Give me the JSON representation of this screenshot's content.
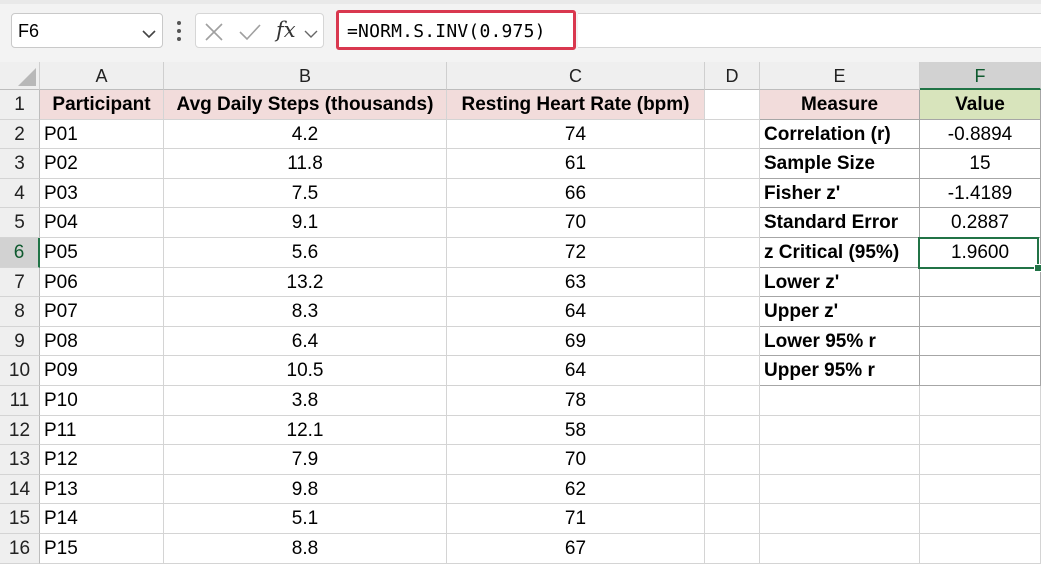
{
  "name_box": {
    "value": "F6",
    "icon": "chevron-down-icon"
  },
  "formula_bar": {
    "formula": "=NORM.S.INV(0.975)",
    "cancel_icon": "close-icon",
    "enter_icon": "checkmark-icon",
    "function_label": "fx",
    "menu_icon": "vertical-dots-icon"
  },
  "columns": [
    "A",
    "B",
    "C",
    "D",
    "E",
    "F"
  ],
  "selected_column": "F",
  "rows": [
    "1",
    "2",
    "3",
    "4",
    "5",
    "6",
    "7",
    "8",
    "9",
    "10",
    "11",
    "12",
    "13",
    "14",
    "15",
    "16"
  ],
  "selected_row": "6",
  "data_table": {
    "headers": [
      "Participant",
      "Avg Daily Steps (thousands)",
      "Resting Heart Rate (bpm)"
    ],
    "rows": [
      [
        "P01",
        "4.2",
        "74"
      ],
      [
        "P02",
        "11.8",
        "61"
      ],
      [
        "P03",
        "7.5",
        "66"
      ],
      [
        "P04",
        "9.1",
        "70"
      ],
      [
        "P05",
        "5.6",
        "72"
      ],
      [
        "P06",
        "13.2",
        "63"
      ],
      [
        "P07",
        "8.3",
        "64"
      ],
      [
        "P08",
        "6.4",
        "69"
      ],
      [
        "P09",
        "10.5",
        "64"
      ],
      [
        "P10",
        "3.8",
        "78"
      ],
      [
        "P11",
        "12.1",
        "58"
      ],
      [
        "P12",
        "7.9",
        "70"
      ],
      [
        "P13",
        "9.8",
        "62"
      ],
      [
        "P14",
        "5.1",
        "71"
      ],
      [
        "P15",
        "8.8",
        "67"
      ]
    ]
  },
  "measures_table": {
    "headers": [
      "Measure",
      "Value"
    ],
    "rows": [
      [
        "Correlation (r)",
        "-0.8894"
      ],
      [
        "Sample Size",
        "15"
      ],
      [
        "Fisher z'",
        "-1.4189"
      ],
      [
        "Standard Error",
        "0.2887"
      ],
      [
        "z Critical (95%)",
        "1.9600"
      ],
      [
        "Lower z'",
        ""
      ],
      [
        "Upper z'",
        ""
      ],
      [
        "Lower 95% r",
        ""
      ],
      [
        "Upper 95% r",
        ""
      ]
    ]
  },
  "colors": {
    "accent_green": "#217346",
    "formula_highlight": "#d9384f",
    "header_pink": "#f2dcdb",
    "header_green": "#d8e4bc"
  }
}
